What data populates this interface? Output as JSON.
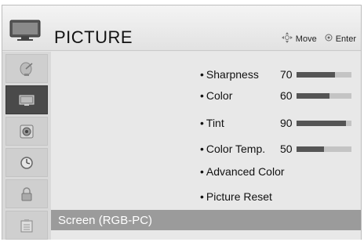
{
  "header": {
    "title": "PICTURE",
    "move_label": "Move",
    "enter_label": "Enter"
  },
  "sidebar": {
    "items": [
      {
        "icon": "satellite-dish-icon",
        "active": false
      },
      {
        "icon": "tv-picture-icon",
        "active": true
      },
      {
        "icon": "speaker-icon",
        "active": false
      },
      {
        "icon": "clock-icon",
        "active": false
      },
      {
        "icon": "lock-icon",
        "active": false
      },
      {
        "icon": "options-box-icon",
        "active": false
      }
    ]
  },
  "menu": {
    "items": [
      {
        "label": "Sharpness",
        "value": "70",
        "level": 70
      },
      {
        "label": "Color",
        "value": "60",
        "level": 60
      },
      {
        "label": "Tint",
        "value": "90",
        "level": 90
      },
      {
        "label": "Color Temp.",
        "value": "50",
        "level": 50
      },
      {
        "label": "Advanced Color"
      },
      {
        "label": "Picture Reset"
      }
    ],
    "selected": "Screen (RGB-PC)"
  },
  "colors": {
    "selected_bg": "#9b9b9b",
    "bar_fill": "#555555",
    "bar_track": "#c4c4c4",
    "active_sidebar": "#4a4a4a"
  }
}
